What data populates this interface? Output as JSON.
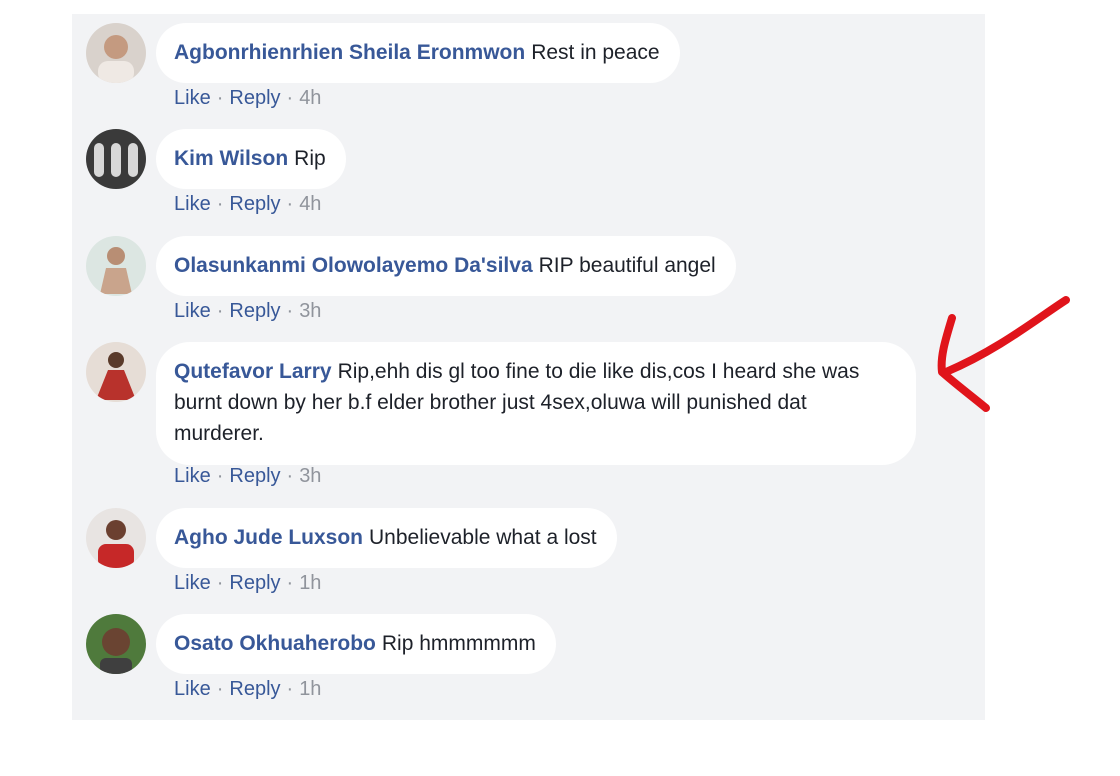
{
  "comments": [
    {
      "author": "Agbonrhienrhien Sheila Eronmwon",
      "text": "Rest in peace",
      "like": "Like",
      "reply": "Reply",
      "time": "4h"
    },
    {
      "author": "Kim Wilson",
      "text": "Rip",
      "like": "Like",
      "reply": "Reply",
      "time": "4h"
    },
    {
      "author": "Olasunkanmi Olowolayemo Da'silva",
      "text": "RIP beautiful angel",
      "like": "Like",
      "reply": "Reply",
      "time": "3h"
    },
    {
      "author": "Qutefavor Larry",
      "text": "Rip,ehh dis gl too fine to die like dis,cos I heard she was burnt down by her b.f elder brother just 4sex,oluwa will punished dat murderer.",
      "like": "Like",
      "reply": "Reply",
      "time": "3h"
    },
    {
      "author": "Agho Jude Luxson",
      "text": "Unbelievable what a lost",
      "like": "Like",
      "reply": "Reply",
      "time": "1h"
    },
    {
      "author": "Osato Okhuaherobo",
      "text": "Rip hmmmmmm",
      "like": "Like",
      "reply": "Reply",
      "time": "1h"
    }
  ],
  "separator": "·",
  "colors": {
    "link": "#385898",
    "text": "#1d2129",
    "meta": "#90949c",
    "background": "#f2f3f5",
    "arrow": "#e0141b"
  },
  "annotation": {
    "icon": "red-arrow-icon"
  }
}
